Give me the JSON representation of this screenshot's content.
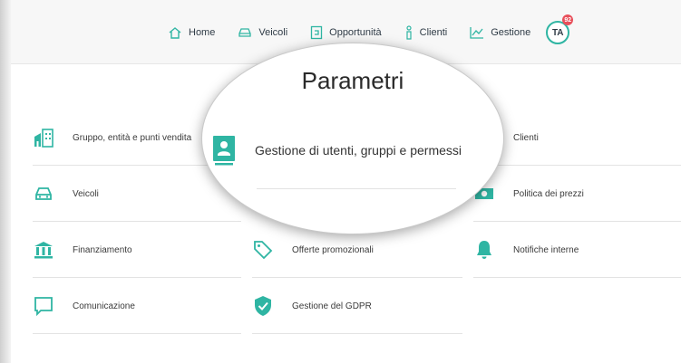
{
  "nav": {
    "items": [
      {
        "label": "Home",
        "icon": "home-icon"
      },
      {
        "label": "Veicoli",
        "icon": "car-icon"
      },
      {
        "label": "Opportunità",
        "icon": "document-icon"
      },
      {
        "label": "Clienti",
        "icon": "person-icon"
      },
      {
        "label": "Gestione",
        "icon": "chart-icon"
      }
    ],
    "avatar": "TA",
    "badge": "92"
  },
  "page": {
    "title": "Parametri"
  },
  "magnified": {
    "label": "Gestione di utenti, gruppi e permessi"
  },
  "grid": {
    "col1": [
      {
        "label": "Gruppo, entità e punti vendita"
      },
      {
        "label": "Veicoli"
      },
      {
        "label": "Finanziamento"
      },
      {
        "label": "Comunicazione"
      }
    ],
    "col2": [
      {
        "label": "Offerte promozionali"
      },
      {
        "label": "Gestione del GDPR"
      }
    ],
    "col3": [
      {
        "label": "Clienti"
      },
      {
        "label": "Politica dei prezzi"
      },
      {
        "label": "Notifiche interne"
      }
    ]
  },
  "colors": {
    "accent": "#2fb5a3",
    "badge": "#e8505b",
    "text": "#3a3a3a"
  }
}
